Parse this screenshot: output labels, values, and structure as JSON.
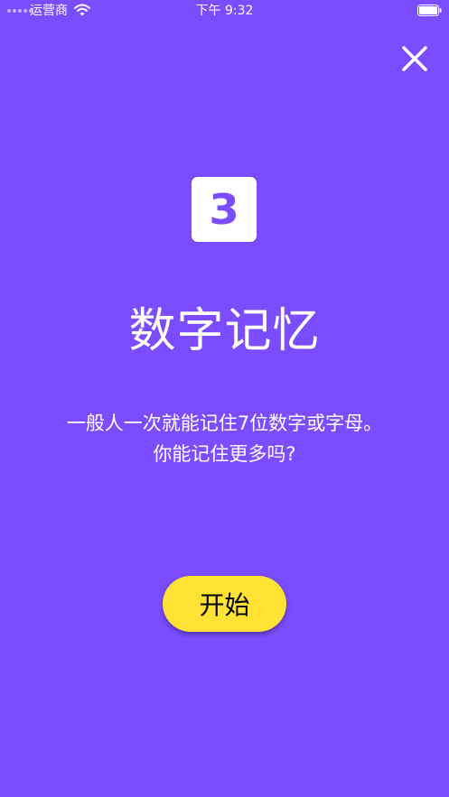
{
  "status_bar": {
    "carrier": "运营商",
    "time": "下午 9:32",
    "icons": [
      "signal-dots-icon",
      "wifi-icon",
      "battery-icon"
    ]
  },
  "close_icon": "close-icon",
  "level_badge": "3",
  "title": "数字记忆",
  "description": {
    "line1": "一般人一次就能记住7位数字或字母。",
    "line2": "你能记住更多吗?"
  },
  "start_button": "开始",
  "colors": {
    "background": "#7B4DFF",
    "button": "#FFE234",
    "text": "#FFFFFF"
  }
}
